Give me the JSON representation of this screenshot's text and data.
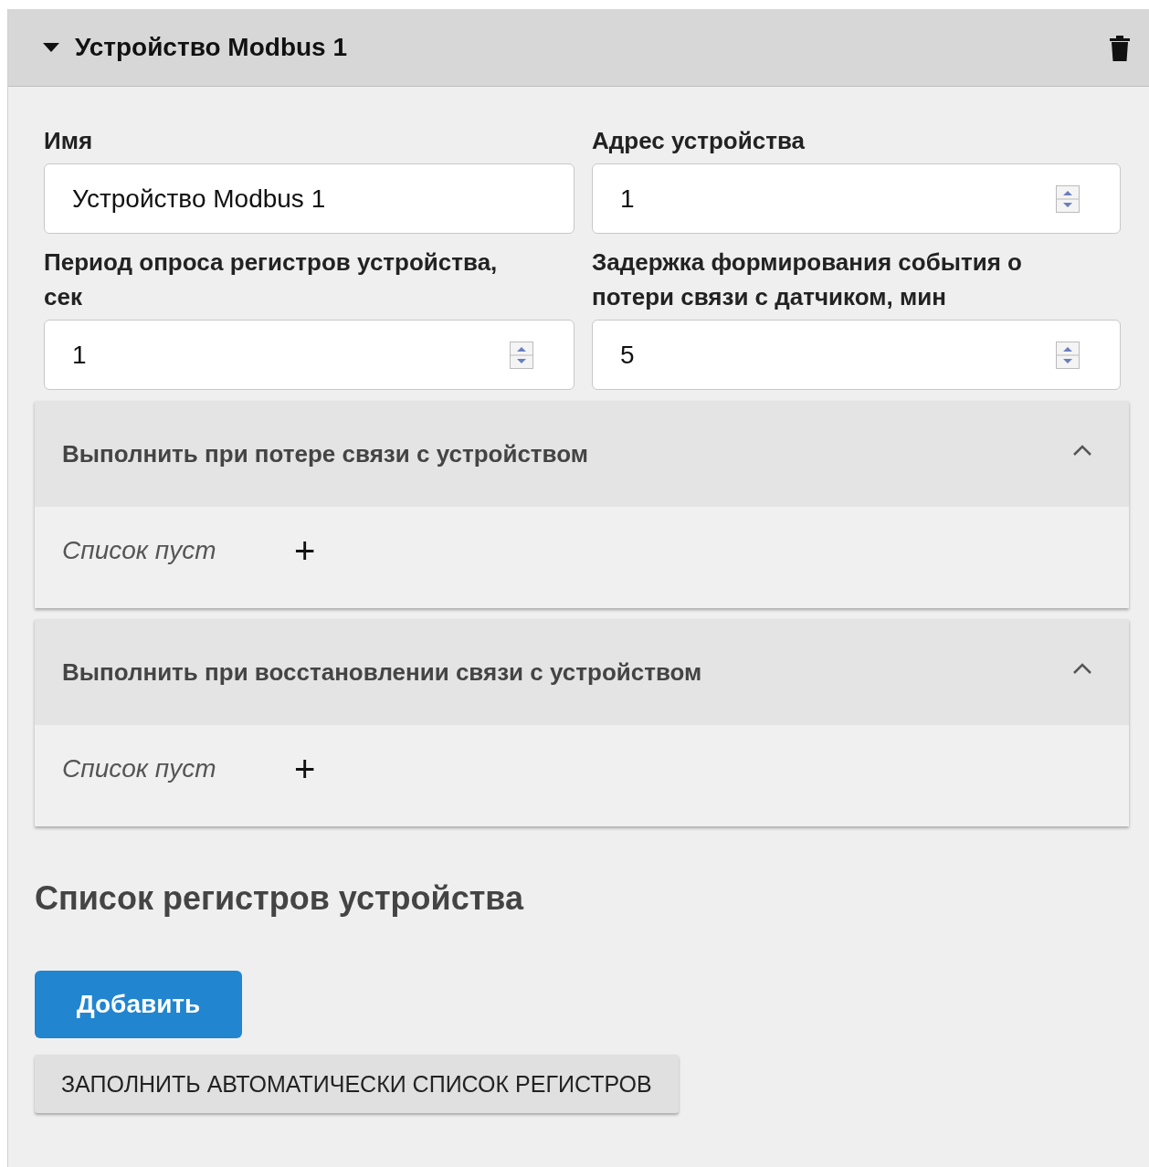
{
  "device": {
    "title": "Устройство Modbus 1",
    "expanded": true,
    "fields": [
      {
        "kind": "text",
        "label": "Имя",
        "value": "Устройство Modbus 1"
      },
      {
        "kind": "number",
        "label": "Адрес устройства",
        "value": "1"
      },
      {
        "kind": "number",
        "label": "Период опроса регистров устройства, сек",
        "value": "1"
      },
      {
        "kind": "number",
        "label": "Задержка формирования события о потери связи с датчиком, мин",
        "value": "5"
      }
    ],
    "sections": [
      {
        "title": "Выполнить при потере связи с устройством",
        "expanded": true,
        "empty_text": "Список пуст",
        "add": "+"
      },
      {
        "title": "Выполнить при восстановлении связи с устройством",
        "expanded": true,
        "empty_text": "Список пуст",
        "add": "+"
      }
    ],
    "registers": {
      "heading": "Список регистров устройства",
      "buttons": [
        {
          "kind": "primary",
          "label": "Добавить"
        },
        {
          "kind": "secondary",
          "label": "ЗАПОЛНИТЬ АВТОМАТИЧЕСКИ СПИСОК РЕГИСТРОВ"
        }
      ]
    }
  }
}
